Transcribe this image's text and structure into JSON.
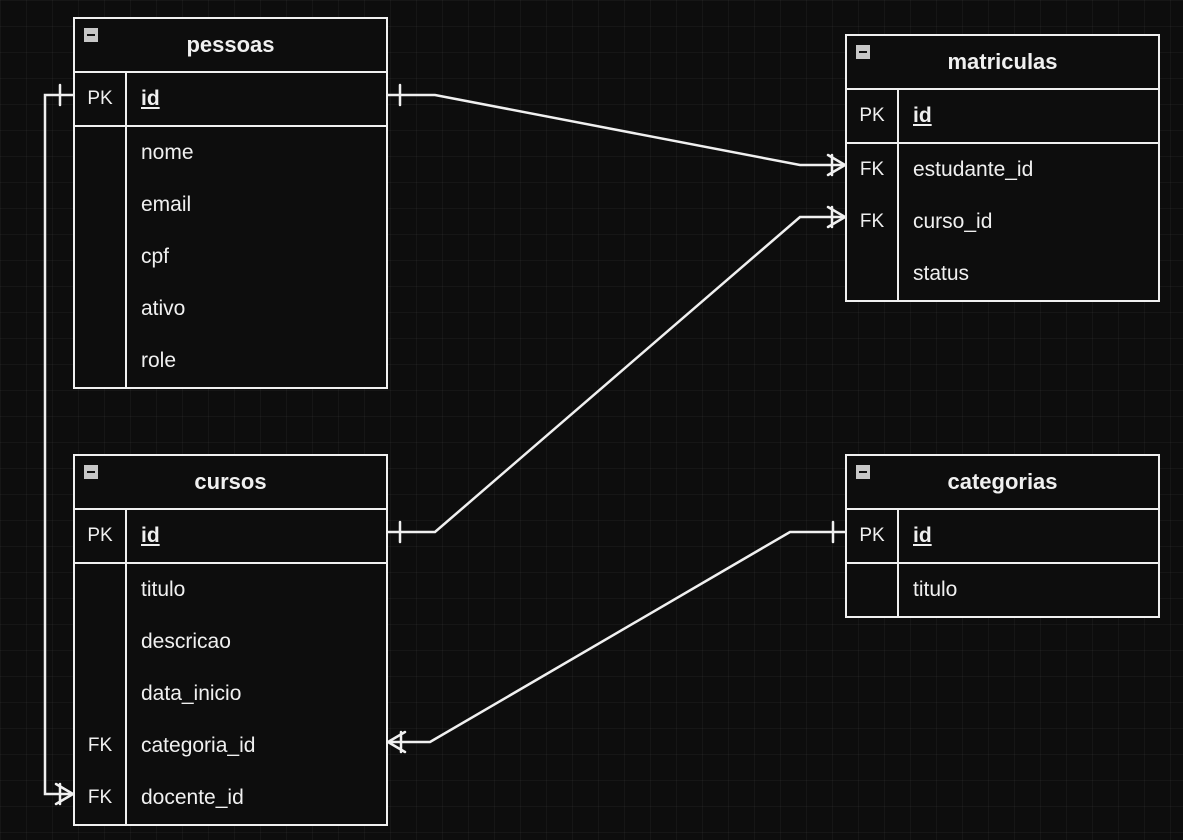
{
  "entities": {
    "pessoas": {
      "title": "pessoas",
      "pk_label": "PK",
      "pk_field": "id",
      "fields": [
        {
          "key": "",
          "name": "nome"
        },
        {
          "key": "",
          "name": "email"
        },
        {
          "key": "",
          "name": "cpf"
        },
        {
          "key": "",
          "name": "ativo"
        },
        {
          "key": "",
          "name": "role"
        }
      ]
    },
    "cursos": {
      "title": "cursos",
      "pk_label": "PK",
      "pk_field": "id",
      "fields": [
        {
          "key": "",
          "name": "titulo"
        },
        {
          "key": "",
          "name": "descricao"
        },
        {
          "key": "",
          "name": "data_inicio"
        },
        {
          "key": "FK",
          "name": "categoria_id"
        },
        {
          "key": "FK",
          "name": "docente_id"
        }
      ]
    },
    "matriculas": {
      "title": "matriculas",
      "pk_label": "PK",
      "pk_field": "id",
      "fields": [
        {
          "key": "FK",
          "name": "estudante_id"
        },
        {
          "key": "FK",
          "name": "curso_id"
        },
        {
          "key": "",
          "name": "status"
        }
      ]
    },
    "categorias": {
      "title": "categorias",
      "pk_label": "PK",
      "pk_field": "id",
      "fields": [
        {
          "key": "",
          "name": "titulo"
        }
      ]
    }
  },
  "relationships": [
    {
      "from": "pessoas.id",
      "to": "matriculas.estudante_id",
      "from_card": "one",
      "to_card": "many"
    },
    {
      "from": "cursos.id",
      "to": "matriculas.curso_id",
      "from_card": "one",
      "to_card": "many"
    },
    {
      "from": "categorias.id",
      "to": "cursos.categoria_id",
      "from_card": "one",
      "to_card": "many"
    },
    {
      "from": "pessoas.id",
      "to": "cursos.docente_id",
      "from_card": "one",
      "to_card": "many"
    }
  ]
}
